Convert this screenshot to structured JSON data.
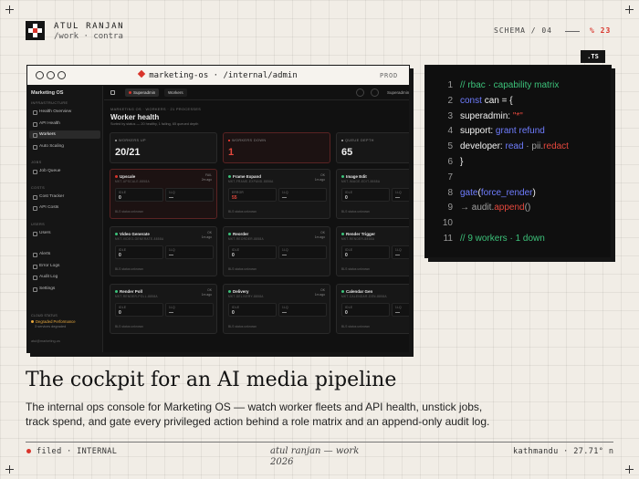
{
  "header": {
    "author": "ATUL RANJAN",
    "path": "/work · contra",
    "schema": "SCHEMA / 04",
    "percent": "% 23"
  },
  "browser": {
    "url": "marketing-os · /internal/admin",
    "env": "PROD"
  },
  "app": {
    "brand": "Marketing OS",
    "sidebar": {
      "sections": [
        {
          "label": "INFRASTRUCTURE",
          "items": [
            {
              "label": "Health Overview"
            },
            {
              "label": "API Health"
            },
            {
              "label": "Workers",
              "active": true
            },
            {
              "label": "Auto Scaling"
            }
          ]
        },
        {
          "label": "JOBS",
          "items": [
            {
              "label": "Job Queue"
            }
          ]
        },
        {
          "label": "COSTS",
          "items": [
            {
              "label": "Cost Tracker"
            },
            {
              "label": "API Costs"
            }
          ]
        },
        {
          "label": "USERS",
          "items": [
            {
              "label": "Users"
            }
          ]
        },
        {
          "label": "",
          "items": [
            {
              "label": "Alerts"
            },
            {
              "label": "Error Logs"
            },
            {
              "label": "Audit Log"
            },
            {
              "label": "Settings"
            }
          ]
        }
      ],
      "status_label": "CLOUD STATUS",
      "status": "Degraded Performance",
      "status_sub": "3 services degraded",
      "footer": "atul@marketing-os"
    },
    "topbar": {
      "crumb_a": "Superadmin",
      "crumb_b": "Workers",
      "user": "Superadmin"
    },
    "page": {
      "crumbs": "MARKETING OS · WORKERS · 21 PROCESSES",
      "title": "Worker health",
      "subtitle": "Sorted by status — 20 healthy, 1 failing, 65 queued depth"
    },
    "stats": [
      {
        "label": "WORKERS UP",
        "value": "20/21"
      },
      {
        "label": "WORKERS DOWN",
        "value": "1",
        "alert": true
      },
      {
        "label": "QUEUE DEPTH",
        "value": "65"
      }
    ],
    "workers": [
      {
        "name": "Upscale",
        "id": "MKT-UPSCALE-8858A",
        "tag_top": "FAIL",
        "tag_bottom": "2m ago",
        "cpu_label": "IDLE",
        "cpu": "0",
        "q_label": "1LQ",
        "q": "—",
        "foot": "BLS status unknown",
        "failed": true
      },
      {
        "name": "Frame Expand",
        "id": "MKT-FRAME-EXPAND-8858A",
        "tag_top": "OK",
        "tag_bottom": "1m ago",
        "cpu_label": "ERROR",
        "cpu": "55",
        "cpu_red": true,
        "q_label": "1LQ",
        "q": "—",
        "foot": "BLS status unknown"
      },
      {
        "name": "Image Edit",
        "id": "MKT-IMAGE-EDIT-8858A",
        "tag_top": "",
        "tag_bottom": "",
        "cpu_label": "IDLE",
        "cpu": "0",
        "q_label": "1LQ",
        "q": "—",
        "foot": "BLS status unknown"
      },
      {
        "name": "Video Generate",
        "id": "MKT-VIDEO-GENERATE-8858A",
        "tag_top": "OK",
        "tag_bottom": "1m ago",
        "cpu_label": "IDLE",
        "cpu": "0",
        "q_label": "1LQ",
        "q": "—",
        "foot": "BLS status unknown"
      },
      {
        "name": "Reorder",
        "id": "MKT-REORDER-8858A",
        "tag_top": "OK",
        "tag_bottom": "1m ago",
        "cpu_label": "IDLE",
        "cpu": "0",
        "q_label": "1LQ",
        "q": "—",
        "foot": "BLS status unknown"
      },
      {
        "name": "Render Trigger",
        "id": "MKT-RENDER-8858A",
        "tag_top": "OK",
        "tag_bottom": "1m ago",
        "cpu_label": "IDLE",
        "cpu": "0",
        "q_label": "1LQ",
        "q": "—",
        "foot": "BLS status unknown"
      },
      {
        "name": "Render Poll",
        "id": "MKT-RENDER-POLL-8858A",
        "tag_top": "OK",
        "tag_bottom": "1m ago",
        "cpu_label": "IDLE",
        "cpu": "0",
        "q_label": "1LQ",
        "q": "—",
        "foot": "BLS status unknown"
      },
      {
        "name": "Delivery",
        "id": "MKT-DELIVERY-8858A",
        "tag_top": "OK",
        "tag_bottom": "1m ago",
        "cpu_label": "IDLE",
        "cpu": "0",
        "q_label": "1LQ",
        "q": "—",
        "foot": "BLS status unknown"
      },
      {
        "name": "Calendar Gen",
        "id": "MKT-CALENDAR-GEN-8858A",
        "tag_top": "",
        "tag_bottom": "",
        "cpu_label": "IDLE",
        "cpu": "0",
        "q_label": "1LQ",
        "q": "—",
        "foot": "BLS status unknown"
      }
    ]
  },
  "code": {
    "tab": ".TS",
    "lines": [
      {
        "n": "1",
        "parts": [
          {
            "t": "// rbac · capability matrix",
            "c": "c-com"
          }
        ]
      },
      {
        "n": "2",
        "parts": [
          {
            "t": "const ",
            "c": "c-kw"
          },
          {
            "t": "can",
            "c": "c-w"
          },
          {
            "t": " = {",
            "c": "c-w"
          }
        ]
      },
      {
        "n": "3",
        "parts": [
          {
            "t": "superadmin",
            "c": "c-w"
          },
          {
            "t": ": ",
            "c": "c-w"
          },
          {
            "t": "\"*\"",
            "c": "c-str"
          }
        ]
      },
      {
        "n": "4",
        "parts": [
          {
            "t": "support",
            "c": "c-w"
          },
          {
            "t": ": ",
            "c": "c-w"
          },
          {
            "t": "grant refund",
            "c": "c-kw"
          }
        ]
      },
      {
        "n": "5",
        "parts": [
          {
            "t": "developer",
            "c": "c-w"
          },
          {
            "t": ": ",
            "c": "c-w"
          },
          {
            "t": "read",
            "c": "c-kw"
          },
          {
            "t": " · pii.",
            "c": "c-g"
          },
          {
            "t": "redact",
            "c": "c-str"
          }
        ]
      },
      {
        "n": "6",
        "parts": [
          {
            "t": "}",
            "c": "c-w"
          }
        ]
      },
      {
        "n": "7",
        "parts": []
      },
      {
        "n": "8",
        "parts": [
          {
            "t": "gate",
            "c": "c-kw"
          },
          {
            "t": "(",
            "c": "c-w"
          },
          {
            "t": "force_render",
            "c": "c-kw"
          },
          {
            "t": ")",
            "c": "c-w"
          }
        ]
      },
      {
        "n": "9",
        "parts": [
          {
            "t": "→ audit.",
            "c": "c-g"
          },
          {
            "t": "append",
            "c": "c-str"
          },
          {
            "t": "()",
            "c": "c-g"
          }
        ]
      },
      {
        "n": "10",
        "parts": []
      },
      {
        "n": "11",
        "parts": [
          {
            "t": "// 9 workers · 1 down",
            "c": "c-com"
          }
        ]
      }
    ]
  },
  "headline": "The cockpit for an AI media pipeline",
  "description": "The internal ops console for Marketing OS — watch worker fleets and API health, unstick jobs, track spend, and gate every privileged action behind a role matrix and an append-only audit log.",
  "footer": {
    "left": "filed · INTERNAL",
    "mid_line1": "atul ranjan — work",
    "mid_line2": "2026",
    "right": "kathmandu · 27.71° n"
  },
  "colors": {
    "accent": "#d9342b",
    "ok": "#3cc27a",
    "keyword": "#6f7dff",
    "warning": "#e8a83c"
  }
}
